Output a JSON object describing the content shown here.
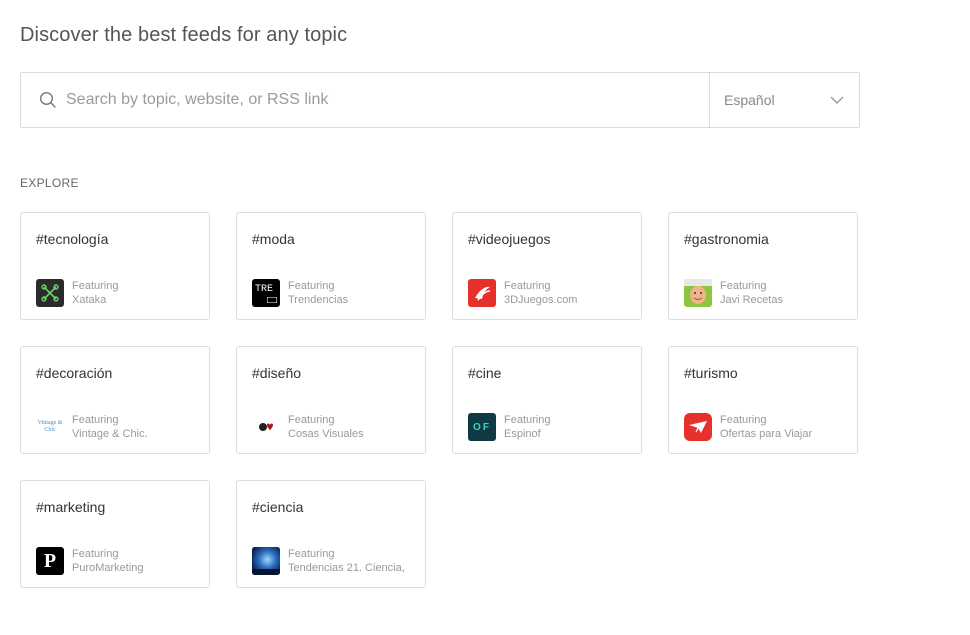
{
  "header": {
    "title": "Discover the best feeds for any topic"
  },
  "search": {
    "placeholder": "Search by topic, website, or RSS link",
    "value": ""
  },
  "language": {
    "selected": "Español"
  },
  "explore": {
    "label": "EXPLORE",
    "featuring_label": "Featuring",
    "cards": [
      {
        "tag": "#tecnología",
        "source": "Xataka",
        "logo": "xataka-logo",
        "logo_text": ""
      },
      {
        "tag": "#moda",
        "source": "Trendencias",
        "logo": "trendencias-logo",
        "logo_text": "TRE"
      },
      {
        "tag": "#videojuegos",
        "source": "3DJuegos.com",
        "logo": "3djuegos-logo",
        "logo_text": ""
      },
      {
        "tag": "#gastronomia",
        "source": "Javi Recetas",
        "logo": "javi-recetas-logo",
        "logo_text": ""
      },
      {
        "tag": "#decoración",
        "source": "Vintage & Chic.",
        "logo": "vintage-chic-logo",
        "logo_text": "Vintage & Chic"
      },
      {
        "tag": "#diseño",
        "source": "Cosas Visuales",
        "logo": "cosas-visuales-logo",
        "logo_text": ""
      },
      {
        "tag": "#cine",
        "source": "Espinof",
        "logo": "espinof-logo",
        "logo_text": "OF"
      },
      {
        "tag": "#turismo",
        "source": "Ofertas para Viajar",
        "logo": "ofertas-viajar-logo",
        "logo_text": ""
      },
      {
        "tag": "#marketing",
        "source": "PuroMarketing",
        "logo": "puromarketing-logo",
        "logo_text": "P"
      },
      {
        "tag": "#ciencia",
        "source": "Tendencias 21. Ciencia,",
        "logo": "tendencias21-logo",
        "logo_text": ""
      }
    ]
  },
  "colors": {
    "border": "#dcdcdc",
    "xataka": "#2b2b2b",
    "xataka_accent": "#6bd26b",
    "red": "#e5302b",
    "espinof": "#0f3a44",
    "espinof_text": "#3fd0c4"
  }
}
